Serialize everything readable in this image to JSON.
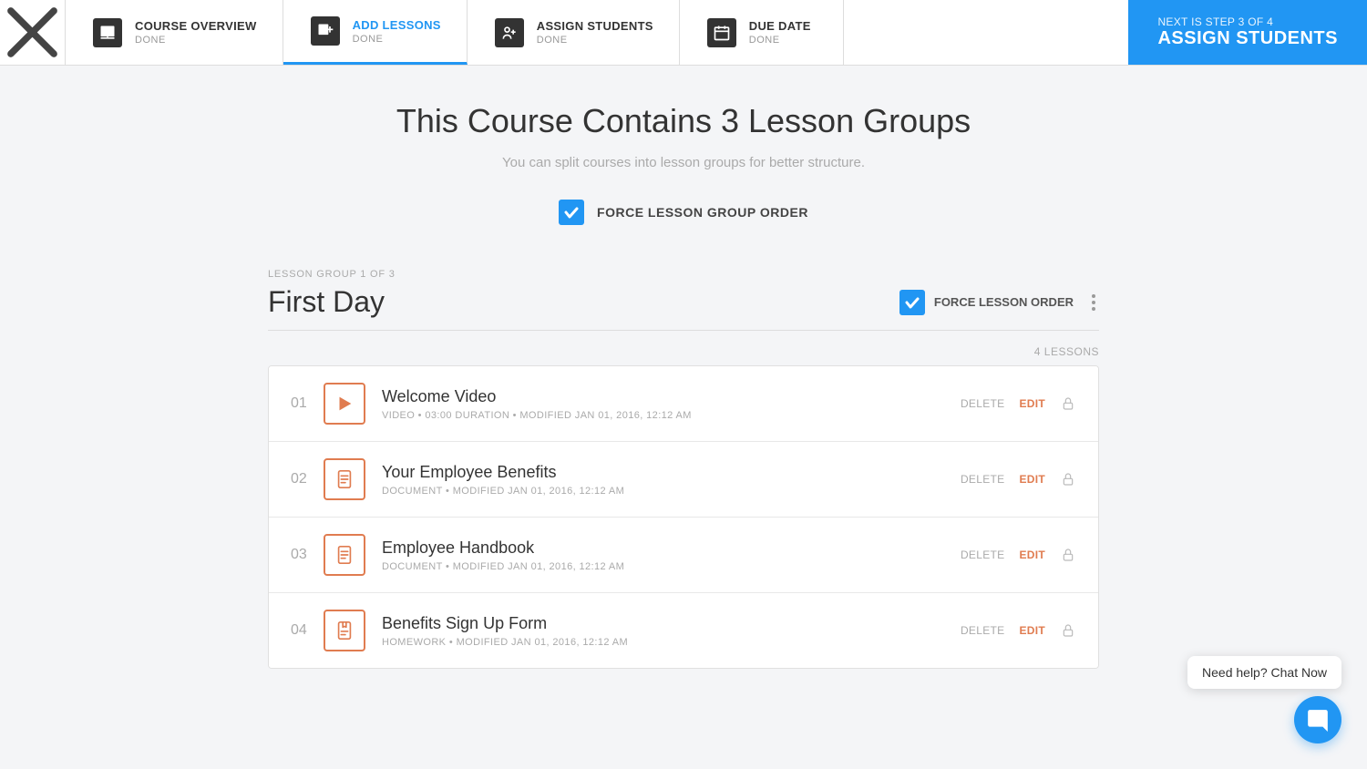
{
  "nav": {
    "close_label": "×",
    "steps": [
      {
        "id": "course-overview",
        "title": "COURSE OVERVIEW",
        "sub": "DONE",
        "active": false,
        "blue": false
      },
      {
        "id": "add-lessons",
        "title": "ADD LESSONS",
        "sub": "DONE",
        "active": true,
        "blue": true
      },
      {
        "id": "assign-students",
        "title": "ASSIGN STUDENTS",
        "sub": "DONE",
        "active": false,
        "blue": false
      },
      {
        "id": "due-date",
        "title": "DUE DATE",
        "sub": "DONE",
        "active": false,
        "blue": false
      }
    ],
    "next_sub": "NEXT IS STEP 3 OF 4",
    "next_label": "ASSIGN STUDENTS"
  },
  "main": {
    "title": "This Course Contains 3 Lesson Groups",
    "subtitle": "You can split courses into lesson groups for better structure.",
    "force_group_order_label": "FORCE LESSON GROUP ORDER",
    "lesson_group": {
      "meta": "LESSON GROUP 1 OF 3",
      "name": "First Day",
      "force_lesson_order_label": "FORCE LESSON ORDER",
      "lessons_count": "4 LESSONS",
      "lessons": [
        {
          "num": "01",
          "title": "Welcome Video",
          "type": "VIDEO",
          "duration": "03:00 DURATION",
          "modified": "Modified Jan 01, 2016, 12:12 AM",
          "icon_type": "video",
          "delete_label": "DELETE",
          "edit_label": "EDIT"
        },
        {
          "num": "02",
          "title": "Your Employee Benefits",
          "type": "DOCUMENT",
          "duration": null,
          "modified": "Modified Jan 01, 2016, 12:12 AM",
          "icon_type": "document",
          "delete_label": "DELETE",
          "edit_label": "EDIT"
        },
        {
          "num": "03",
          "title": "Employee Handbook",
          "type": "DOCUMENT",
          "duration": null,
          "modified": "Modified Jan 01, 2016, 12:12 AM",
          "icon_type": "document",
          "delete_label": "DELETE",
          "edit_label": "EDIT"
        },
        {
          "num": "04",
          "title": "Benefits Sign Up Form",
          "type": "HOMEWORK",
          "duration": null,
          "modified": "Modified Jan 01, 2016, 12:12 AM",
          "icon_type": "homework",
          "delete_label": "DELETE",
          "edit_label": "EDIT"
        }
      ]
    }
  },
  "chat": {
    "bubble": "Need help? Chat Now"
  }
}
